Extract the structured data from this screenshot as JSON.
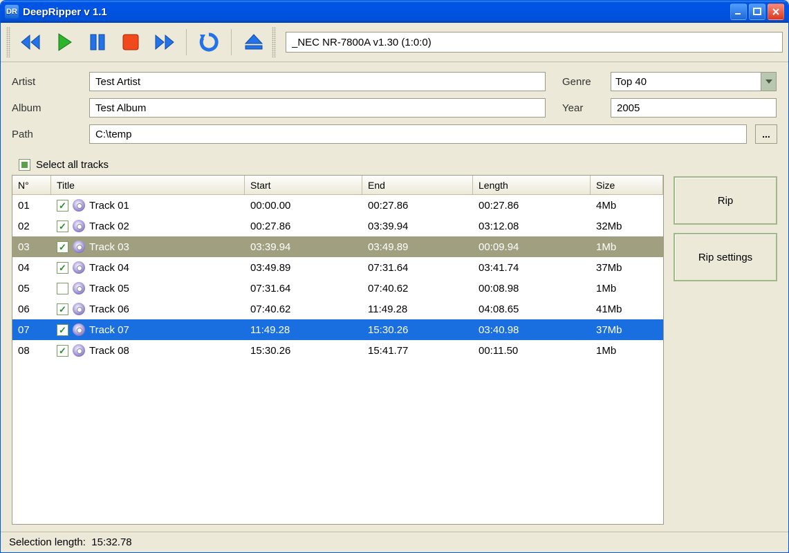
{
  "title": "DeepRipper v 1.1",
  "titlebar_icon_text": "DR",
  "toolbar": {
    "drive": "_NEC NR-7800A v1.30 (1:0:0)"
  },
  "form": {
    "artist_label": "Artist",
    "artist_value": "Test Artist",
    "album_label": "Album",
    "album_value": "Test Album",
    "path_label": "Path",
    "path_value": "C:\\temp",
    "genre_label": "Genre",
    "genre_value": "Top 40",
    "year_label": "Year",
    "year_value": "2005",
    "browse_label": "..."
  },
  "select_all_label": "Select all tracks",
  "columns": {
    "no": "N°",
    "title": "Title",
    "start": "Start",
    "end": "End",
    "length": "Length",
    "size": "Size"
  },
  "tracks": [
    {
      "no": "01",
      "checked": true,
      "title": "Track 01",
      "start": "00:00.00",
      "end": "00:27.86",
      "length": "00:27.86",
      "size": "4Mb",
      "state": ""
    },
    {
      "no": "02",
      "checked": true,
      "title": "Track 02",
      "start": "00:27.86",
      "end": "03:39.94",
      "length": "03:12.08",
      "size": "32Mb",
      "state": ""
    },
    {
      "no": "03",
      "checked": true,
      "title": "Track 03",
      "start": "03:39.94",
      "end": "03:49.89",
      "length": "00:09.94",
      "size": "1Mb",
      "state": "olive"
    },
    {
      "no": "04",
      "checked": true,
      "title": "Track 04",
      "start": "03:49.89",
      "end": "07:31.64",
      "length": "03:41.74",
      "size": "37Mb",
      "state": ""
    },
    {
      "no": "05",
      "checked": false,
      "title": "Track 05",
      "start": "07:31.64",
      "end": "07:40.62",
      "length": "00:08.98",
      "size": "1Mb",
      "state": ""
    },
    {
      "no": "06",
      "checked": true,
      "title": "Track 06",
      "start": "07:40.62",
      "end": "11:49.28",
      "length": "04:08.65",
      "size": "41Mb",
      "state": ""
    },
    {
      "no": "07",
      "checked": true,
      "title": "Track 07",
      "start": "11:49.28",
      "end": "15:30.26",
      "length": "03:40.98",
      "size": "37Mb",
      "state": "blue"
    },
    {
      "no": "08",
      "checked": true,
      "title": "Track 08",
      "start": "15:30.26",
      "end": "15:41.77",
      "length": "00:11.50",
      "size": "1Mb",
      "state": ""
    }
  ],
  "buttons": {
    "rip": "Rip",
    "rip_settings": "Rip settings"
  },
  "status": {
    "label": "Selection length:",
    "value": "15:32.78"
  }
}
